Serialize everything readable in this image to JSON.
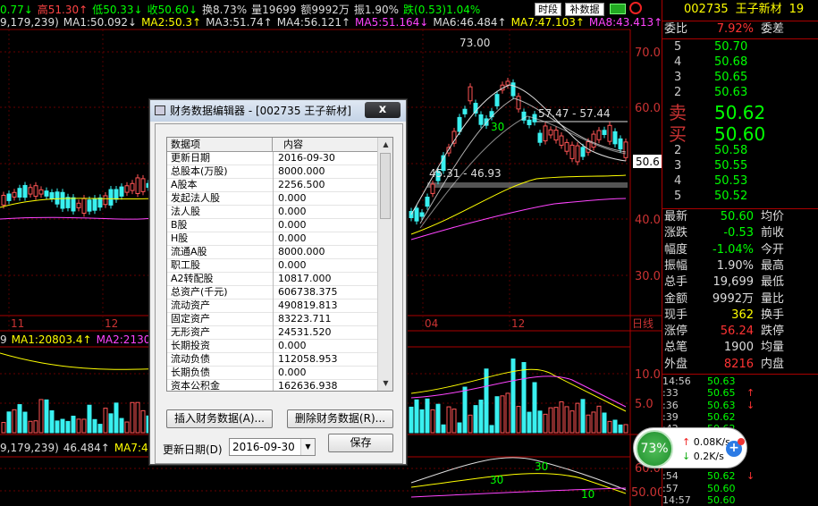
{
  "top_bar": {
    "items": [
      {
        "text": "0.77↓",
        "color": "#0f0"
      },
      {
        "text": "高51.30↑",
        "color": "#ff4444"
      },
      {
        "text": "低50.33↓",
        "color": "#0f0"
      },
      {
        "text": "收50.60↓",
        "color": "#0f0"
      },
      {
        "text": "换8.73%",
        "color": "#ddd"
      },
      {
        "text": "量19699",
        "color": "#ddd"
      },
      {
        "text": "额9992万",
        "color": "#ddd"
      },
      {
        "text": "振1.90%",
        "color": "#ddd"
      },
      {
        "text": "跌(0.53)1.04%",
        "color": "#0f0"
      }
    ],
    "btn_timeshare": "时段",
    "btn_fill_data": "补数据"
  },
  "ma_bar_main": [
    {
      "text": "9,179,239)",
      "color": "#ddd"
    },
    {
      "text": "MA1:50.092↓",
      "color": "#ddd"
    },
    {
      "text": "MA2:50.3↑",
      "color": "#ffff00"
    },
    {
      "text": "MA3:51.74↑",
      "color": "#ddd"
    },
    {
      "text": "MA4:56.121↑",
      "color": "#ddd"
    },
    {
      "text": "MA5:51.164↓",
      "color": "#ff44ff"
    },
    {
      "text": "MA6:46.484↑",
      "color": "#ddd"
    },
    {
      "text": "MA7:47.103↑",
      "color": "#ffff00"
    },
    {
      "text": "MA8:43.413↑",
      "color": "#ff44ff"
    }
  ],
  "ma_bar_vol": [
    {
      "text": "9",
      "color": "#ddd"
    },
    {
      "text": "MA1:20803.4↑",
      "color": "#ffff00"
    },
    {
      "text": "MA2:21301",
      "color": "#ff44ff"
    }
  ],
  "ma_bar_sub": [
    {
      "text": "9,179,239)",
      "color": "#ddd"
    },
    {
      "text": "46.484↑",
      "color": "#ddd"
    },
    {
      "text": "MA7:47.103↑",
      "color": "#ffff00"
    },
    {
      "text": "MA8:43.413↑",
      "color": "#ff44ff"
    }
  ],
  "chart_data": {
    "type": "candlestick",
    "price_axis_ticks": [
      "70.0",
      "60.0",
      "50.0",
      "40.0",
      "30.0"
    ],
    "vol_axis_ticks": [
      "10.0",
      "5.0"
    ],
    "sub_axis_ticks": [
      "60.0",
      "50.00"
    ],
    "current_price_tag": "50.6",
    "x_labels": [
      "11",
      "12",
      "04",
      "12"
    ],
    "period_label": "日线",
    "annotations": [
      "73.00",
      "57.47 - 57.44",
      "45.31 - 46.93",
      "30",
      "30",
      "10",
      "30"
    ]
  },
  "quote_panel": {
    "code": "002735",
    "name": "王子新材",
    "suffix": "19",
    "weibi_label": "委比",
    "weibi_value": "7.92%",
    "weicha_label": "委差",
    "sell_side_label": "卖",
    "buy_side_label": "买",
    "asks": [
      {
        "level": "5",
        "price": "50.70",
        "vol": ""
      },
      {
        "level": "4",
        "price": "50.68",
        "vol": ""
      },
      {
        "level": "3",
        "price": "50.65",
        "vol": ""
      },
      {
        "level": "2",
        "price": "50.63",
        "vol": ""
      }
    ],
    "ask1": "50.62",
    "bid1": "50.60",
    "bids": [
      {
        "level": "2",
        "price": "50.58",
        "vol": ""
      },
      {
        "level": "3",
        "price": "50.55",
        "vol": ""
      },
      {
        "level": "4",
        "price": "50.53",
        "vol": ""
      },
      {
        "level": "5",
        "price": "50.52",
        "vol": ""
      }
    ],
    "stats": [
      {
        "k": "最新",
        "v": "50.60",
        "vcolor": "#0f0",
        "k2": "均价",
        "v2": ""
      },
      {
        "k": "涨跌",
        "v": "-0.53",
        "vcolor": "#0f0",
        "k2": "前收",
        "v2": ""
      },
      {
        "k": "幅度",
        "v": "-1.04%",
        "vcolor": "#0f0",
        "k2": "今开",
        "v2": ""
      },
      {
        "k": "振幅",
        "v": "1.90%",
        "vcolor": "#ddd",
        "k2": "最高",
        "v2": ""
      },
      {
        "k": "总手",
        "v": "19,699",
        "vcolor": "#ddd",
        "k2": "最低",
        "v2": ""
      },
      {
        "k": "金额",
        "v": "9992万",
        "vcolor": "#ddd",
        "k2": "量比",
        "v2": ""
      },
      {
        "k": "现手",
        "v": "362",
        "vcolor": "#ff0",
        "k2": "换手",
        "v2": ""
      },
      {
        "k": "涨停",
        "v": "56.24",
        "vcolor": "#f33",
        "k2": "跌停",
        "v2": ""
      },
      {
        "k": "总笔",
        "v": "1900",
        "vcolor": "#ddd",
        "k2": "均量",
        "v2": ""
      },
      {
        "k": "外盘",
        "v": "8216",
        "vcolor": "#f33",
        "k2": "内盘",
        "v2": ""
      }
    ],
    "ticks": [
      {
        "t": "14:56",
        "p": "50.63",
        "a": ""
      },
      {
        "t": ":33",
        "p": "50.65",
        "a": "↑"
      },
      {
        "t": ":36",
        "p": "50.63",
        "a": "↓"
      },
      {
        "t": ":39",
        "p": "50.62",
        "a": ""
      },
      {
        "t": ":42",
        "p": "50.62",
        "a": ""
      },
      {
        "t": ":45",
        "p": "",
        "a": ""
      },
      {
        "t": ":48",
        "p": "",
        "a": ""
      },
      {
        "t": ":51",
        "p": "",
        "a": ""
      },
      {
        "t": ":54",
        "p": "50.62",
        "a": "↓"
      },
      {
        "t": ":57",
        "p": "50.60",
        "a": ""
      },
      {
        "t": "14:57",
        "p": "50.60",
        "a": ""
      }
    ]
  },
  "dialog": {
    "title": "财务数据编辑器 - [002735 王子新材]",
    "close_label": "x",
    "col_item": "数据项",
    "col_value": "内容",
    "rows": [
      {
        "k": "更新日期",
        "v": "2016-09-30"
      },
      {
        "k": "总股本(万股)",
        "v": "8000.000"
      },
      {
        "k": "A股本",
        "v": "2256.500"
      },
      {
        "k": "发起法人股",
        "v": "0.000"
      },
      {
        "k": "法人股",
        "v": "0.000"
      },
      {
        "k": "B股",
        "v": "0.000"
      },
      {
        "k": "H股",
        "v": "0.000"
      },
      {
        "k": "流通A股",
        "v": "8000.000"
      },
      {
        "k": "职工股",
        "v": "0.000"
      },
      {
        "k": "A2转配股",
        "v": "10817.000"
      },
      {
        "k": "总资产(千元)",
        "v": "606738.375"
      },
      {
        "k": "流动资产",
        "v": "490819.813"
      },
      {
        "k": "固定资产",
        "v": "83223.711"
      },
      {
        "k": "无形资产",
        "v": "24531.520"
      },
      {
        "k": "长期投资",
        "v": "0.000"
      },
      {
        "k": "流动负债",
        "v": "112058.953"
      },
      {
        "k": "长期负债",
        "v": "0.000"
      },
      {
        "k": "资本公积金",
        "v": "162636.938"
      }
    ],
    "insert_btn": "插入财务数据(A)...",
    "delete_btn": "删除财务数据(R)...",
    "date_label": "更新日期(D)",
    "date_value": "2016-09-30",
    "save_btn": "保存"
  },
  "net_widget": {
    "percent": "73%",
    "up": "0.08K/s",
    "down": "0.2K/s"
  }
}
